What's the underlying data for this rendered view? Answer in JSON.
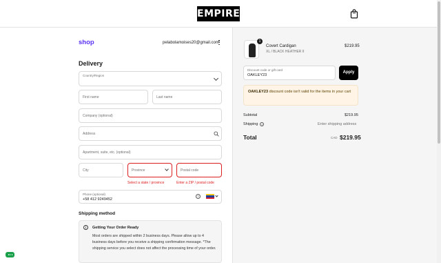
{
  "header": {
    "logo": "EMPIRE",
    "cart_icon": "bag-icon"
  },
  "account": {
    "shop_label": "shop",
    "email": "pelabolamoises20@gmail.com"
  },
  "delivery": {
    "heading": "Delivery",
    "country_label": "Country/Region",
    "first_name_placeholder": "First name",
    "last_name_placeholder": "Last name",
    "company_placeholder": "Company (optional)",
    "address_placeholder": "Address",
    "apartment_placeholder": "Apartment, suite, etc. (optional)",
    "city_placeholder": "City",
    "province_placeholder": "Province",
    "postal_placeholder": "Postal code",
    "province_error": "Select a state / province",
    "postal_error": "Enter a ZIP / postal code",
    "phone_label": "Phone (optional)",
    "phone_value": "+58 412 9249452"
  },
  "shipping": {
    "heading": "Shipping method",
    "notice_title": "Getting Your Order Ready",
    "notice_body": "Most orders are shipped within 2 business days. Please allow up to 4 business days before you receive a shipping confirmation message. *The shipping service you select does not affect the processing time of your order."
  },
  "order": {
    "quantity": "1",
    "product_name": "Covert Cardigan",
    "product_variant": "XL / BLACK HEATHER II",
    "product_price": "$219.95",
    "discount_label": "Discount code or gift card",
    "discount_value": "OAKLEY23",
    "apply_label": "Apply",
    "warning_code": "OAKLEY23",
    "warning_text": " discount code isn't valid for the items in your cart",
    "subtotal_label": "Subtotal",
    "subtotal_value": "$219.95",
    "shipping_label": "Shipping",
    "shipping_value": "Enter shipping address",
    "total_label": "Total",
    "total_currency": "CAD",
    "total_value": "$219.95"
  },
  "colors": {
    "accent": "#5a31f4",
    "error": "#dd1d1d",
    "warning_bg": "#fff4e5",
    "chat": "#1aa04a"
  }
}
